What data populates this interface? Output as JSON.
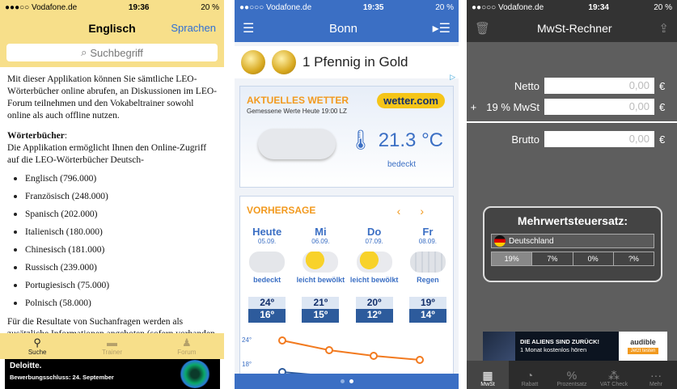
{
  "p1": {
    "status": {
      "carrier": "●●●○○ Vodafone.de",
      "time": "19:36",
      "battery": "20 %"
    },
    "nav": {
      "title": "Englisch",
      "right": "Sprachen"
    },
    "search": {
      "placeholder": "Suchbegriff"
    },
    "intro": "Mit dieser Applikation können Sie sämtliche LEO-Wörterbücher online abrufen, an Diskussionen im LEO-Forum teilnehmen und den Vokabeltrainer sowohl online als auch offline nutzen.",
    "dict_heading": "Wörterbücher",
    "dict_text": "Die Applikation ermöglicht Ihnen den Online-Zugriff auf die LEO-Wörterbücher Deutsch-",
    "languages": [
      "Englisch (796.000)",
      "Französisch (248.000)",
      "Spanisch (202.000)",
      "Italienisch (180.000)",
      "Chinesisch (181.000)",
      "Russisch (239.000)",
      "Portugiesisch (75.000)",
      "Polnisch (58.000)"
    ],
    "outro": "Für die Resultate von Suchanfragen werden als zusätzliche Informationen angeboten (sofern vorhanden",
    "tabs": [
      {
        "label": "Suche",
        "icon": "search-icon"
      },
      {
        "label": "Trainer",
        "icon": "trainer-icon"
      },
      {
        "label": "Forum",
        "icon": "person-icon"
      }
    ],
    "ad": {
      "brand": "Deloitte.",
      "text": "Bewerbungsschluss: 24. September"
    }
  },
  "p2": {
    "status": {
      "carrier": "●●○○○ Vodafone.de",
      "time": "19:35",
      "battery": "20 %"
    },
    "nav": {
      "title": "Bonn"
    },
    "ad": {
      "text": "1 Pfennig in Gold"
    },
    "weather": {
      "header": "AKTUELLES WETTER",
      "sub": "Gemessene Werte Heute 19:00 LZ",
      "logo": "wetter.com",
      "temp": "21.3 °C",
      "cond": "bedeckt"
    },
    "forecast": {
      "header": "VORHERSAGE",
      "days": [
        {
          "name": "Heute",
          "date": "05.09.",
          "cond": "bedeckt",
          "hi": "24º",
          "lo": "16º"
        },
        {
          "name": "Mi",
          "date": "06.09.",
          "cond": "leicht bewölkt",
          "hi": "21º",
          "lo": "15º"
        },
        {
          "name": "Do",
          "date": "07.09.",
          "cond": "leicht bewölkt",
          "hi": "20º",
          "lo": "12º"
        },
        {
          "name": "Fr",
          "date": "08.09.",
          "cond": "Regen",
          "hi": "19º",
          "lo": "14º"
        }
      ],
      "graph_labels": [
        "24°",
        "18°"
      ]
    }
  },
  "p3": {
    "status": {
      "carrier": "●●○○○ Vodafone.de",
      "time": "19:34",
      "battery": "20 %"
    },
    "nav": {
      "title": "MwSt-Rechner"
    },
    "netto": {
      "label": "Netto",
      "value": "0,00",
      "cur": "€"
    },
    "tax": {
      "sign": "+",
      "label": "19 % MwSt",
      "value": "0,00",
      "cur": "€"
    },
    "brutto": {
      "label": "Brutto",
      "value": "0,00",
      "cur": "€"
    },
    "panel": {
      "title": "Mehrwertsteuersatz:",
      "country": "Deutschland",
      "rates": [
        "19%",
        "7%",
        "0%",
        "?%"
      ]
    },
    "ad": {
      "line1": "DIE ALIENS SIND ZURÜCK!",
      "line2": "1 Monat kostenlos hören",
      "brand": "audible",
      "cta": "Jetzt testen"
    },
    "tabs": [
      "MwSt",
      "Rabatt",
      "Prozentsatz",
      "VAT Check",
      "Mehr"
    ]
  }
}
